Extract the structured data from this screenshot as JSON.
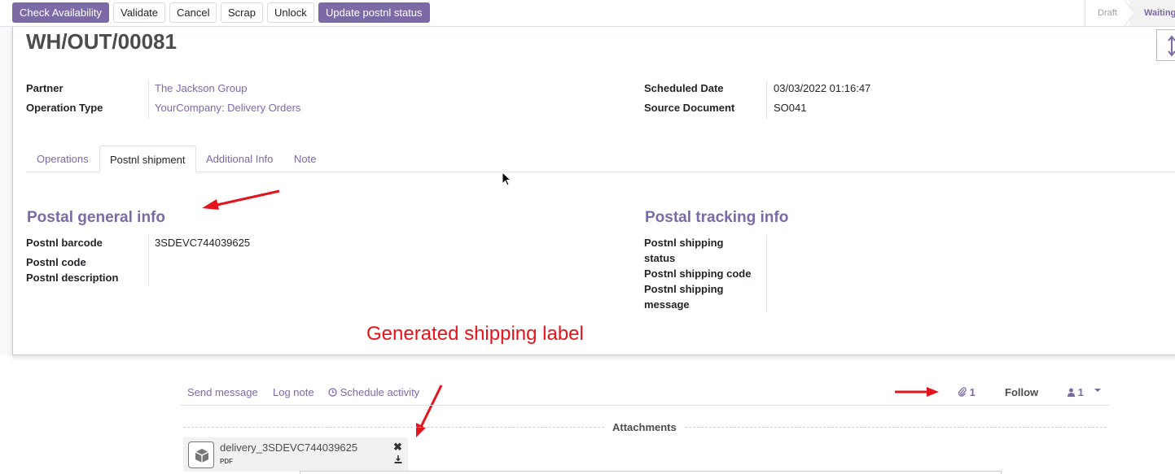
{
  "toolbar": {
    "check_availability": "Check Availability",
    "validate": "Validate",
    "cancel": "Cancel",
    "scrap": "Scrap",
    "unlock": "Unlock",
    "update_status": "Update postnl status"
  },
  "status": {
    "draft": "Draft",
    "waiting": "Waiting"
  },
  "record": {
    "title": "WH/OUT/00081",
    "partner_label": "Partner",
    "partner_value": "The Jackson Group",
    "operation_type_label": "Operation Type",
    "operation_type_value": "YourCompany: Delivery Orders",
    "scheduled_date_label": "Scheduled Date",
    "scheduled_date_value": "03/03/2022 01:16:47",
    "source_document_label": "Source Document",
    "source_document_value": "SO041"
  },
  "tabs": [
    {
      "label": "Operations"
    },
    {
      "label": "Postnl shipment"
    },
    {
      "label": "Additional Info"
    },
    {
      "label": "Note"
    }
  ],
  "postal_general": {
    "title": "Postal general info",
    "barcode_label": "Postnl barcode",
    "barcode_value": "3SDEVC744039625",
    "code_label": "Postnl code",
    "description_label": "Postnl description"
  },
  "postal_tracking": {
    "title": "Postal tracking info",
    "status_label_1": "Postnl shipping",
    "status_label_2": "status",
    "code_label": "Postnl shipping code",
    "message_label_1": "Postnl shipping",
    "message_label_2": "message"
  },
  "annotation": {
    "generated_label": "Generated shipping label",
    "arrow_color": "#e3141b"
  },
  "chatter": {
    "send_message": "Send message",
    "log_note": "Log note",
    "schedule_activity": "Schedule activity",
    "attachment_count": "1",
    "follow": "Follow",
    "follower_count": "1",
    "attachments_title": "Attachments"
  },
  "attachment": {
    "name": "delivery_3SDEVC744039625",
    "ext": "PDF"
  },
  "colors": {
    "primary": "#7c6aa6",
    "text": "#212529"
  }
}
